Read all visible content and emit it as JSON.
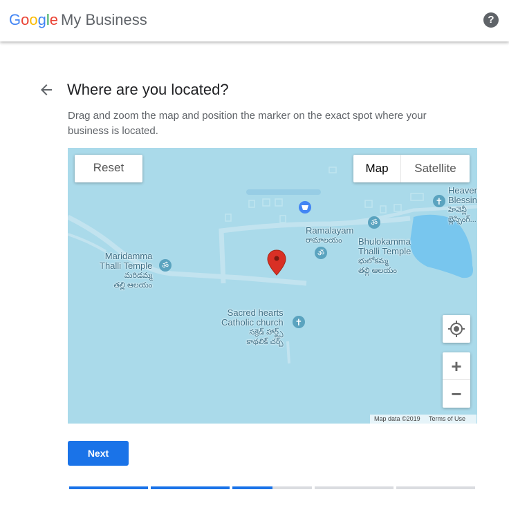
{
  "header": {
    "brand_letters": [
      "G",
      "o",
      "o",
      "g",
      "l",
      "e"
    ],
    "product": "My Business",
    "help_icon": "help-circle-icon",
    "help_glyph": "?"
  },
  "page": {
    "back_icon": "arrow-back-icon",
    "title": "Where are you located?",
    "description": "Drag and zoom the map and position the marker on the exact spot where your business is located."
  },
  "map": {
    "reset_label": "Reset",
    "map_type": {
      "map_label": "Map",
      "satellite_label": "Satellite",
      "selected": "Map"
    },
    "zoom_in_label": "+",
    "zoom_out_label": "−",
    "locate_icon": "my-location-icon",
    "marker_icon": "map-pin-icon",
    "pois": [
      {
        "name": "Maridamma\nThalli Temple",
        "native": "మరిడమ్మ\nతల్లి ఆలయం",
        "icon": "temple-icon"
      },
      {
        "name": "Ramalayam",
        "native": "రామాలయం",
        "icon": "temple-icon"
      },
      {
        "name": "Bhulokamma\nThalli Temple",
        "native": "భులోకమ్మ\nతల్లి ఆలయం",
        "icon": "temple-icon"
      },
      {
        "name": "Sacred hearts\nCatholic church",
        "native": "సక్రెడ్ హార్ట్స్\nకాథలిక్ చర్చ్",
        "icon": "church-icon"
      },
      {
        "name": "Heaven\nBlessin",
        "native": "హెవెన్లీ\nబ్లెస్సింగ్...",
        "icon": "church-icon"
      }
    ],
    "attribution": {
      "data": "Map data ©2019",
      "terms": "Terms of Use"
    },
    "colors": {
      "water": "#aadaea",
      "lake": "#78c6ee",
      "road": "#c2e3ef",
      "poi": "#5aa3bf",
      "marker": "#d93025"
    }
  },
  "footer": {
    "next_label": "Next",
    "progress": [
      1,
      1,
      0.5,
      0,
      0
    ],
    "colors": {
      "accent": "#1a73e8",
      "track": "#dadce0"
    }
  }
}
